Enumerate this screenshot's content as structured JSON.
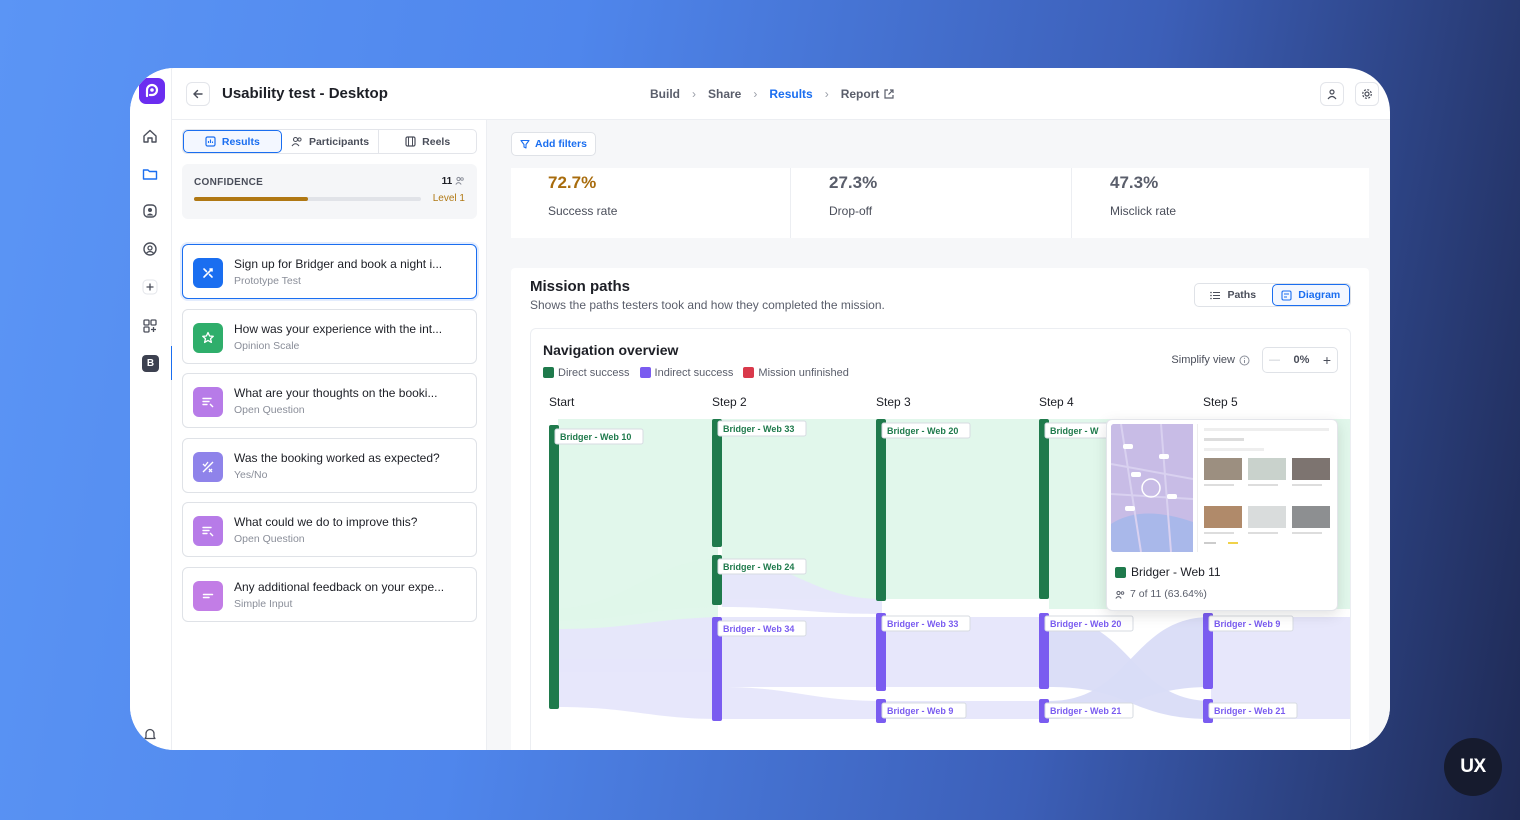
{
  "header": {
    "title": "Usability test - Desktop",
    "crumbs": [
      "Build",
      "Share",
      "Results",
      "Report"
    ]
  },
  "left": {
    "tabs": [
      "Results",
      "Participants",
      "Reels"
    ],
    "confidence": {
      "label": "CONFIDENCE",
      "count": "11",
      "level": "Level 1",
      "progress": 0.5
    },
    "questions": [
      {
        "title": "Sign up for Bridger and book a night i...",
        "type": "Prototype Test",
        "color": "#1a6ef0",
        "icon": "prototype-icon"
      },
      {
        "title": "How was your experience with the int...",
        "type": "Opinion Scale",
        "color": "#2fae6b",
        "icon": "star-icon"
      },
      {
        "title": "What are your thoughts on the booki...",
        "type": "Open Question",
        "color": "#b77be8",
        "icon": "open-question-icon"
      },
      {
        "title": "Was the booking worked as expected?",
        "type": "Yes/No",
        "color": "#8f83ea",
        "icon": "yes-no-icon"
      },
      {
        "title": "What could we do to improve this?",
        "type": "Open Question",
        "color": "#b77be8",
        "icon": "open-question-icon"
      },
      {
        "title": "Any additional feedback on your expe...",
        "type": "Simple Input",
        "color": "#c27de6",
        "icon": "simple-input-icon"
      }
    ]
  },
  "main": {
    "add_filters": "Add filters",
    "stats": [
      {
        "value": "72.7%",
        "label": "Success rate",
        "color": "#a86c0d"
      },
      {
        "value": "27.3%",
        "label": "Drop-off",
        "color": "#5a5e6b"
      },
      {
        "value": "47.3%",
        "label": "Misclick rate",
        "color": "#5a5e6b"
      }
    ],
    "mission_paths": {
      "title": "Mission paths",
      "subtitle": "Shows the paths testers took and how they completed the mission.",
      "view_options": [
        "Paths",
        "Diagram"
      ]
    },
    "navigation": {
      "title": "Navigation overview",
      "legend": [
        {
          "label": "Direct success",
          "color": "#1f7a4c"
        },
        {
          "label": "Indirect success",
          "color": "#7a5cf0"
        },
        {
          "label": "Mission unfinished",
          "color": "#d9394b"
        }
      ],
      "simplify_label": "Simplify view",
      "simplify_value": "0%",
      "steps": [
        "Start",
        "Step 2",
        "Step 3",
        "Step 4",
        "Step 5"
      ],
      "nodes": {
        "start": "Bridger - Web 10",
        "s2a": "Bridger - Web 33",
        "s2b": "Bridger - Web 24",
        "s2c": "Bridger - Web 34",
        "s3a": "Bridger - Web 20",
        "s3b": "Bridger - Web 33",
        "s3c": "Bridger - Web 9",
        "s4a": "Bridger - W",
        "s4b": "Bridger - Web 20",
        "s4c": "Bridger - Web 21",
        "s5b": "Bridger - Web 9",
        "s5c": "Bridger - Web 21"
      },
      "tooltip": {
        "label": "Bridger - Web 11",
        "count": "7 of 11 (63.64%)"
      }
    }
  },
  "badge": "UX"
}
